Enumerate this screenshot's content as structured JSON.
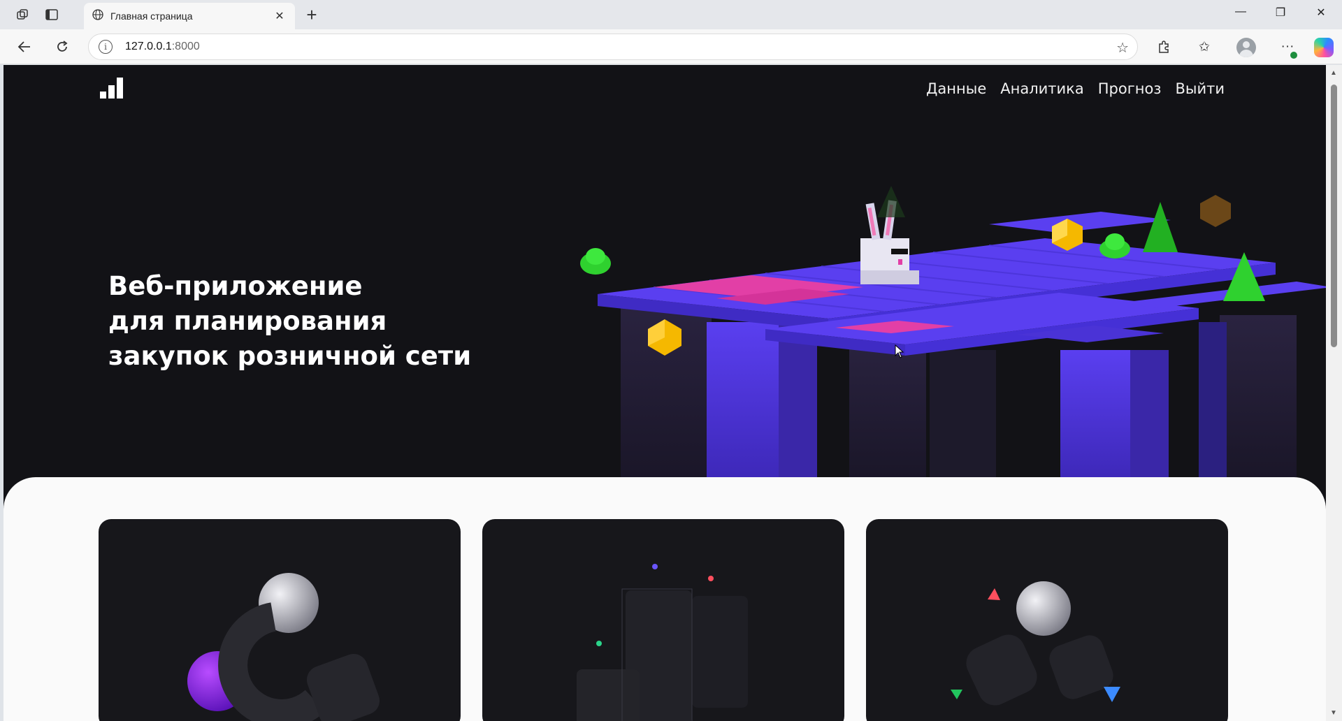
{
  "browser": {
    "tab_title": "Главная страница",
    "url_host": "127.0.0.1",
    "url_port": ":8000",
    "icons": [
      "workspaces-icon",
      "tab-actions-icon",
      "globe-icon",
      "close-icon",
      "new-tab-icon",
      "minimize-icon",
      "restore-icon",
      "window-close-icon",
      "back-icon",
      "refresh-icon",
      "site-info-icon",
      "favorite-star-icon",
      "extensions-icon",
      "favorites-icon",
      "profile-avatar",
      "more-menu-icon",
      "copilot-icon"
    ]
  },
  "header": {
    "logo": "bar-chart-logo",
    "nav": [
      "Данные",
      "Аналитика",
      "Прогноз",
      "Выйти"
    ]
  },
  "hero": {
    "title_lines": [
      "Веб-приложение",
      "для планирования",
      "закупок розничной сети"
    ]
  },
  "colors": {
    "page_bg": "#121216",
    "platform_purple": "#5a3ff0",
    "platform_pink": "#e23fa6",
    "gem_yellow": "#f5b800",
    "bush_green": "#2fd12f",
    "content_bg": "#fafafa",
    "card_bg": "#17171b"
  }
}
